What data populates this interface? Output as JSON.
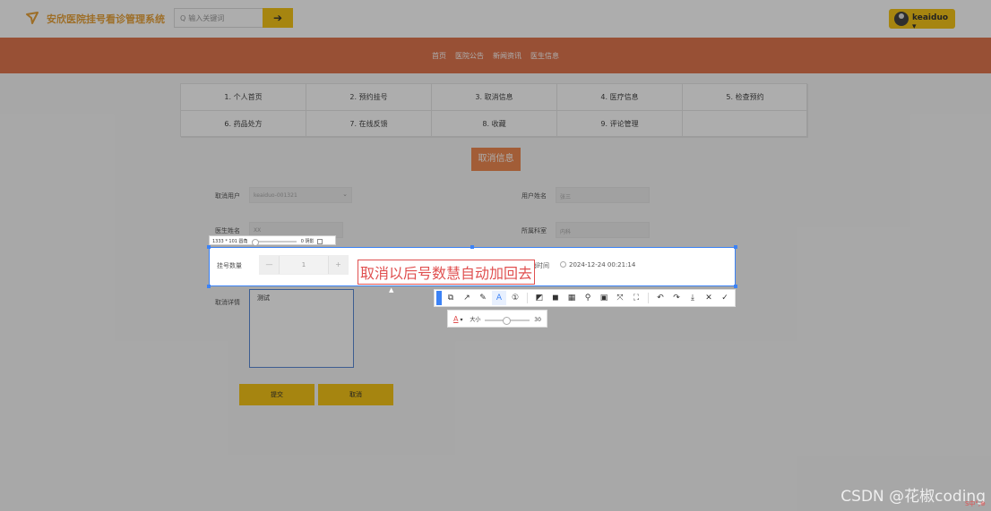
{
  "header": {
    "brand": "安欣医院挂号看诊管理系统",
    "search_placeholder": "输入关键词",
    "search_button": "➔",
    "user_name": "keaiduo ▾"
  },
  "nav": [
    "首页",
    "医院公告",
    "新闻资讯",
    "医生信息"
  ],
  "menu": [
    "1. 个人首页",
    "2. 预约挂号",
    "3. 取消信息",
    "4. 医疗信息",
    "5. 检查预约",
    "6. 药品处方",
    "7. 在线反馈",
    "8. 收藏",
    "9. 评论管理",
    ""
  ],
  "section_title": "取消信息",
  "form": {
    "cancel_user_label": "取消用户",
    "cancel_user_value": "keaiduo-001321",
    "username_label": "用户姓名",
    "username_value": "张三",
    "doctor_name_label": "医生姓名",
    "doctor_name_value": "XX",
    "department_label": "所属科室",
    "department_value": "内科",
    "count_label": "挂号数量",
    "count_value": "1",
    "minus": "—",
    "plus": "+",
    "cancel_time_label": "取消时间",
    "cancel_time_value": "2024-12-24 00:21:14",
    "detail_label": "取消详情",
    "detail_value": "测试",
    "submit": "提交",
    "cancel": "取消"
  },
  "capture": {
    "size_text": "1333 * 101",
    "rounded_label": "圆角",
    "rounded_value": "0",
    "shadow_label": "阴影",
    "annotation": "取消以后号数慧自动加回去",
    "tools": [
      "⧉",
      "↗",
      "✎",
      "A",
      "①",
      "◩",
      "◼",
      "▦",
      "⚲",
      "▣",
      "⤧",
      "⛶",
      "↶",
      "↷",
      "⤓",
      "✕",
      "✓"
    ],
    "size_label": "大小",
    "font_size_value": "30",
    "color_label": "A"
  },
  "watermark": "CSDN @花椒coding",
  "tray": "S中°,⊕"
}
